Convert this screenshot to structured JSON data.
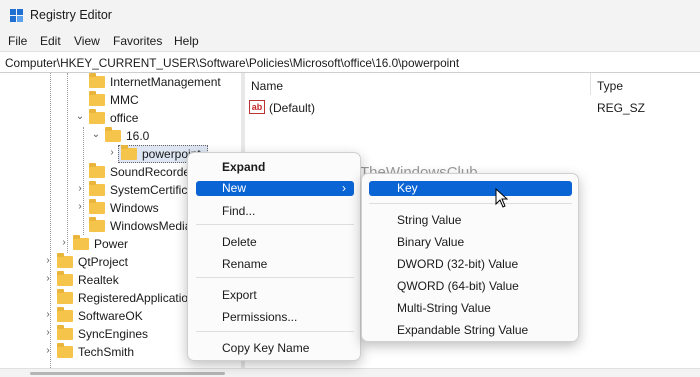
{
  "window": {
    "title": "Registry Editor"
  },
  "menubar": [
    "File",
    "Edit",
    "View",
    "Favorites",
    "Help"
  ],
  "address": "Computer\\HKEY_CURRENT_USER\\Software\\Policies\\Microsoft\\office\\16.0\\powerpoint",
  "tree": {
    "items": [
      {
        "label": "InternetManagement",
        "expander": "",
        "selected": false
      },
      {
        "label": "MMC",
        "expander": "",
        "selected": false
      },
      {
        "label": "office",
        "expander": "expanded",
        "selected": false
      },
      {
        "label": "16.0",
        "expander": "expanded",
        "selected": false
      },
      {
        "label": "powerpoint",
        "expander": "collapsed",
        "selected": true
      },
      {
        "label": "SoundRecorder",
        "expander": "",
        "selected": false
      },
      {
        "label": "SystemCertificates",
        "expander": "collapsed",
        "selected": false
      },
      {
        "label": "Windows",
        "expander": "collapsed",
        "selected": false
      },
      {
        "label": "WindowsMediaPlayer",
        "expander": "",
        "selected": false
      },
      {
        "label": "Power",
        "expander": "collapsed",
        "selected": false
      },
      {
        "label": "QtProject",
        "expander": "collapsed",
        "selected": false
      },
      {
        "label": "Realtek",
        "expander": "collapsed",
        "selected": false
      },
      {
        "label": "RegisteredApplications",
        "expander": "",
        "selected": false
      },
      {
        "label": "SoftwareOK",
        "expander": "collapsed",
        "selected": false
      },
      {
        "label": "SyncEngines",
        "expander": "collapsed",
        "selected": false
      },
      {
        "label": "TechSmith",
        "expander": "collapsed",
        "selected": false
      }
    ]
  },
  "list": {
    "columns": {
      "name": "Name",
      "type": "Type"
    },
    "rows": [
      {
        "name": "(Default)",
        "type": "REG_SZ",
        "icon": "string-value-icon"
      }
    ]
  },
  "context_menu": {
    "items": [
      {
        "label": "Expand",
        "bold": true
      },
      {
        "label": "New",
        "highlighted": true,
        "submenu": true
      },
      {
        "label": "Find..."
      },
      {
        "label": "Delete"
      },
      {
        "label": "Rename"
      },
      {
        "label": "Export"
      },
      {
        "label": "Permissions..."
      },
      {
        "label": "Copy Key Name"
      }
    ]
  },
  "submenu": {
    "items": [
      {
        "label": "Key",
        "highlighted": true
      },
      {
        "label": "String Value"
      },
      {
        "label": "Binary Value"
      },
      {
        "label": "DWORD (32-bit) Value"
      },
      {
        "label": "QWORD (64-bit) Value"
      },
      {
        "label": "Multi-String Value"
      },
      {
        "label": "Expandable String Value"
      }
    ]
  },
  "watermark": {
    "text": "TheWindowsClub"
  },
  "colors": {
    "accent": "#0a64d4",
    "folder": "#f4c54a",
    "selection": "#dde6f2"
  }
}
